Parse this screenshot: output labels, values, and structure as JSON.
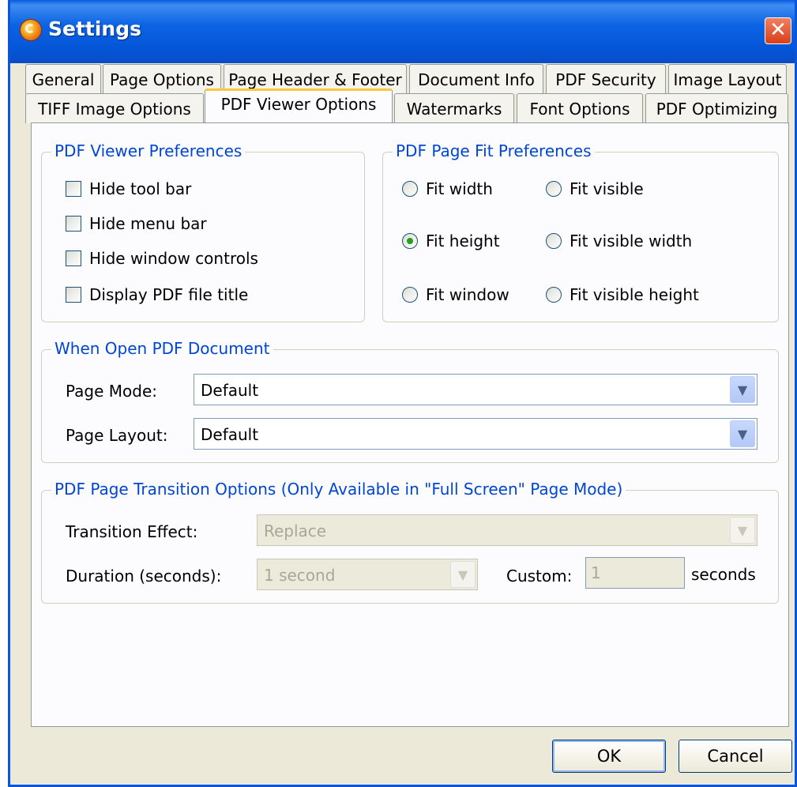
{
  "window": {
    "title": "Settings"
  },
  "tabs_row1": [
    "General",
    "Page Options",
    "Page Header & Footer",
    "Document Info",
    "PDF Security",
    "Image Layout"
  ],
  "tabs_row2": [
    "TIFF Image Options",
    "PDF Viewer Options",
    "Watermarks",
    "Font Options",
    "PDF Optimizing"
  ],
  "active_tab": "PDF Viewer Options",
  "viewer_prefs": {
    "legend": "PDF Viewer Preferences",
    "options": [
      {
        "label": "Hide tool bar",
        "checked": false
      },
      {
        "label": "Hide menu bar",
        "checked": false
      },
      {
        "label": "Hide window controls",
        "checked": false
      },
      {
        "label": "Display PDF file title",
        "checked": false
      }
    ]
  },
  "page_fit": {
    "legend": "PDF Page Fit Preferences",
    "options": [
      {
        "label": "Fit width",
        "selected": false
      },
      {
        "label": "Fit visible",
        "selected": false
      },
      {
        "label": "Fit height",
        "selected": true
      },
      {
        "label": "Fit visible width",
        "selected": false
      },
      {
        "label": "Fit window",
        "selected": false
      },
      {
        "label": "Fit visible height",
        "selected": false
      }
    ]
  },
  "open_doc": {
    "legend": "When Open PDF Document",
    "page_mode_label": "Page Mode:",
    "page_mode_value": "Default",
    "page_layout_label": "Page Layout:",
    "page_layout_value": "Default"
  },
  "transition": {
    "legend": "PDF Page Transition Options (Only Available in \"Full Screen\" Page Mode)",
    "effect_label": "Transition Effect:",
    "effect_value": "Replace",
    "duration_label": "Duration (seconds):",
    "duration_value": "1 second",
    "custom_label": "Custom:",
    "custom_value": "1",
    "seconds_label": "seconds"
  },
  "buttons": {
    "ok": "OK",
    "cancel": "Cancel"
  }
}
